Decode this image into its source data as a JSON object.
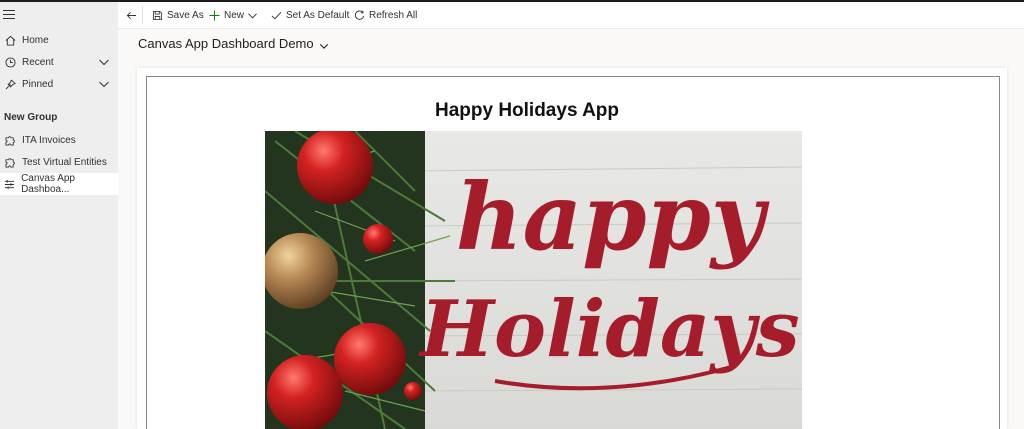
{
  "sidebar": {
    "items": [
      {
        "label": "Home",
        "icon": "home-icon"
      },
      {
        "label": "Recent",
        "icon": "clock-icon"
      },
      {
        "label": "Pinned",
        "icon": "pin-icon"
      }
    ],
    "group_title": "New Group",
    "group_items": [
      {
        "label": "ITA Invoices",
        "icon": "puzzle-icon"
      },
      {
        "label": "Test Virtual Entities",
        "icon": "puzzle-icon"
      },
      {
        "label": "Canvas App Dashboa...",
        "icon": "dashboard-icon"
      }
    ]
  },
  "toolbar": {
    "save_as": "Save As",
    "new": "New",
    "set_default": "Set As Default",
    "refresh": "Refresh All"
  },
  "page": {
    "title": "Canvas App Dashboard Demo"
  },
  "app": {
    "title": "Happy Holidays App",
    "hero_text_1": "happy",
    "hero_text_2": "Holidays"
  },
  "colors": {
    "accent_green": "#107c10",
    "ornament_red": "#c4161c",
    "lettering_red": "#a51d2b"
  }
}
